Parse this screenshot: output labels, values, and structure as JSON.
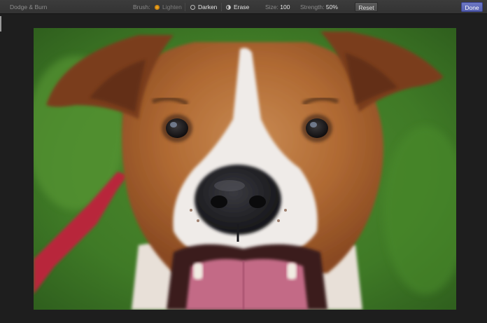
{
  "toolbar": {
    "title": "Dodge & Burn",
    "brush_label": "Brush:",
    "tools": {
      "lighten": "Lighten",
      "darken": "Darken",
      "erase": "Erase"
    },
    "selected_tool": "lighten",
    "size_label": "Size:",
    "size_value": "100",
    "strength_label": "Strength:",
    "strength_value": "50%",
    "reset_label": "Reset",
    "done_label": "Done"
  },
  "icons": {
    "lighten": "radio-selected-icon",
    "darken": "radio-unselected-icon",
    "erase": "eraser-icon"
  },
  "colors": {
    "accent_done": "#5f69ba",
    "radio_selected": "#e7a521",
    "toolbar_bg": "#383838",
    "canvas_bg": "#1e1e1e"
  }
}
